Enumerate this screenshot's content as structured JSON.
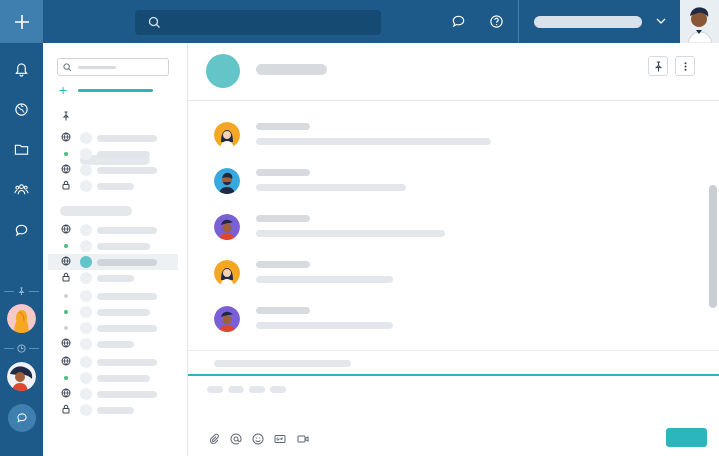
{
  "app": {
    "colors": {
      "nav_bg": "#1d5a8a",
      "nav_active": "#3f7fb0",
      "search_bg": "#154a73",
      "accent": "#2bb5bd",
      "channel_avatar": "#64c5c8",
      "online": "#4cbf7f",
      "offline": "#cfd3d8"
    }
  },
  "rail": {
    "icons": [
      "plus-icon",
      "bell-icon",
      "globe-icon",
      "folder-icon",
      "team-icon",
      "chat-bubble-icon"
    ],
    "separators": [
      "pin-icon",
      "clock-icon"
    ],
    "avatars": [
      "favorite-avatar",
      "recent-avatar"
    ]
  },
  "topbar": {
    "search_icon": "search-icon",
    "icons": [
      "threads-icon",
      "help-icon"
    ],
    "user_menu_icon": "chevron-down-icon"
  },
  "sidebar": {
    "search_icon": "search-icon",
    "add_icon": "plus-icon",
    "pinned_icon": "pin-icon",
    "rows": [
      {
        "icon": "globe"
      },
      {
        "icon": "online"
      },
      {
        "icon": "globe"
      },
      {
        "icon": "lock"
      },
      {
        "icon": "globe"
      },
      {
        "icon": "online"
      },
      {
        "icon": "globe",
        "active": true
      },
      {
        "icon": "lock"
      },
      {
        "icon": "offline"
      },
      {
        "icon": "online"
      },
      {
        "icon": "offline"
      },
      {
        "icon": "globe"
      },
      {
        "icon": "globe"
      },
      {
        "icon": "online"
      },
      {
        "icon": "globe"
      },
      {
        "icon": "lock"
      }
    ]
  },
  "main": {
    "header_buttons": [
      "pin-icon",
      "more-vertical-icon"
    ],
    "messages": [
      {
        "avatar": "woman-avatar",
        "bg": "#f5a623"
      },
      {
        "avatar": "bearded-man-avatar",
        "bg": "#38a8df"
      },
      {
        "avatar": "man-cap-avatar",
        "bg": "#7b5fd6"
      },
      {
        "avatar": "woman-avatar",
        "bg": "#f5a623"
      },
      {
        "avatar": "man-cap-avatar",
        "bg": "#7b5fd6"
      }
    ],
    "composer_tools": [
      "attach-icon",
      "mention-icon",
      "emoji-icon",
      "gif-icon",
      "video-icon"
    ]
  }
}
